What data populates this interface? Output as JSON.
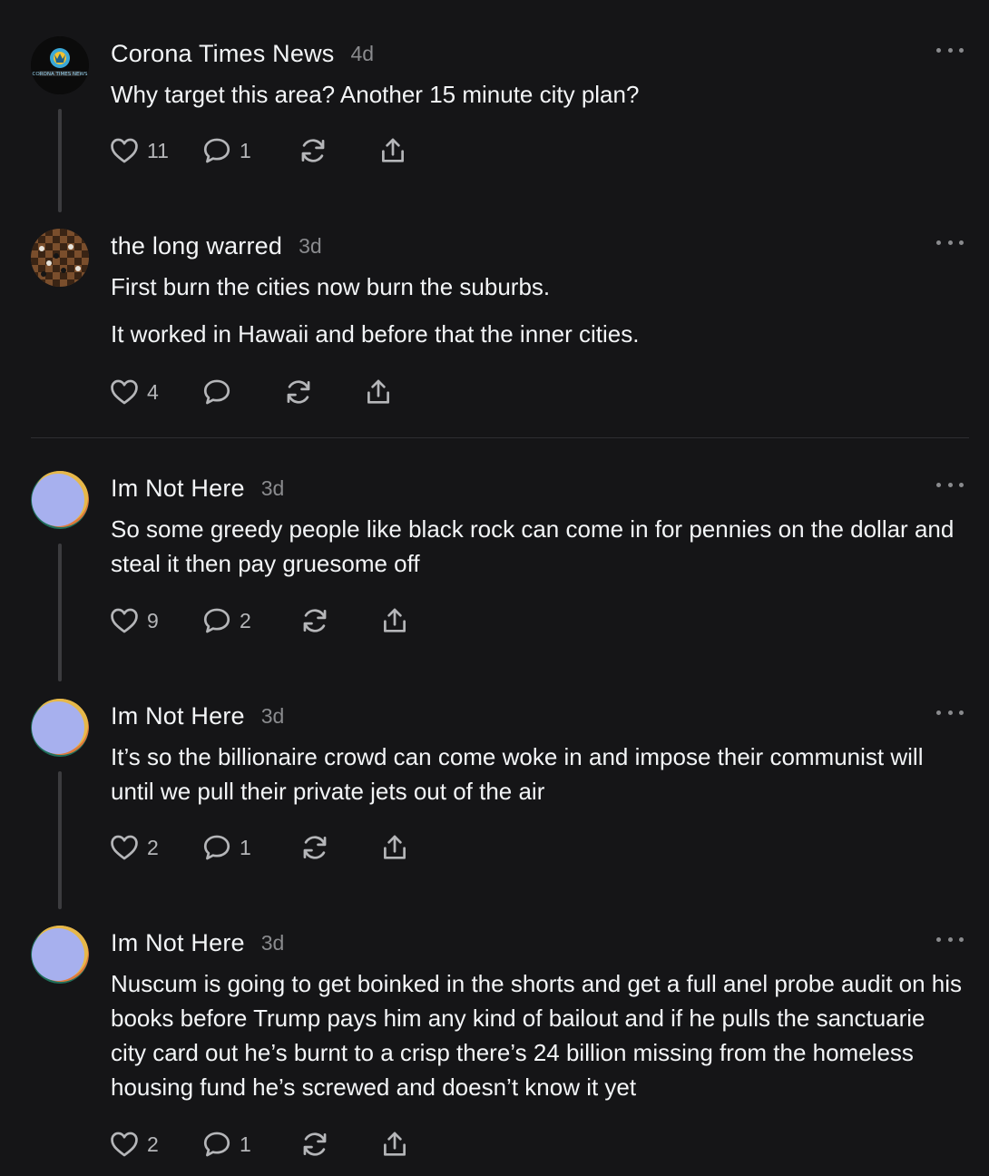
{
  "posts": [
    {
      "username": "Corona Times News",
      "time": "4d",
      "avatar": "corona-times-news-avatar",
      "avatar_text": "CORONA TIMES NEWS",
      "paragraphs": [
        "Why target this area? Another 15 minute city plan?"
      ],
      "likes": "11",
      "replies": "1"
    },
    {
      "username": "the long warred",
      "time": "3d",
      "avatar": "chessboard-avatar",
      "paragraphs": [
        "First burn the cities now burn the suburbs.",
        "It worked in Hawaii and before that the inner cities."
      ],
      "likes": "4",
      "replies": ""
    },
    {
      "username": "Im Not Here",
      "time": "3d",
      "avatar": "abstract-gradient-avatar",
      "paragraphs": [
        "So some greedy people like black rock can come in for pennies on the dollar and steal it then pay gruesome off"
      ],
      "likes": "9",
      "replies": "2"
    },
    {
      "username": "Im Not Here",
      "time": "3d",
      "avatar": "abstract-gradient-avatar",
      "paragraphs": [
        "It’s so the billionaire crowd can come woke in and impose their communist will until we pull their private jets out of the air"
      ],
      "likes": "2",
      "replies": "1"
    },
    {
      "username": "Im Not Here",
      "time": "3d",
      "avatar": "abstract-gradient-avatar",
      "paragraphs": [
        "Nuscum is going to get boinked in the shorts and get a full anel probe audit on his books before Trump pays him any kind of bailout and if he pulls the sanctuarie city card out he’s burnt to a crisp there’s 24 billion missing from the homeless housing fund he’s screwed and doesn’t know it yet"
      ],
      "likes": "2",
      "replies": "1"
    }
  ],
  "icons": {
    "like": "heart-icon",
    "reply": "speech-bubble-icon",
    "repost": "repost-icon",
    "share": "share-icon",
    "more": "more-dots-icon"
  },
  "colors": {
    "background": "#151517",
    "text_primary": "#f3f5f7",
    "text_secondary": "#8a8b8e",
    "icon": "#b5b6b9",
    "thread_line": "#3c3c3f"
  }
}
